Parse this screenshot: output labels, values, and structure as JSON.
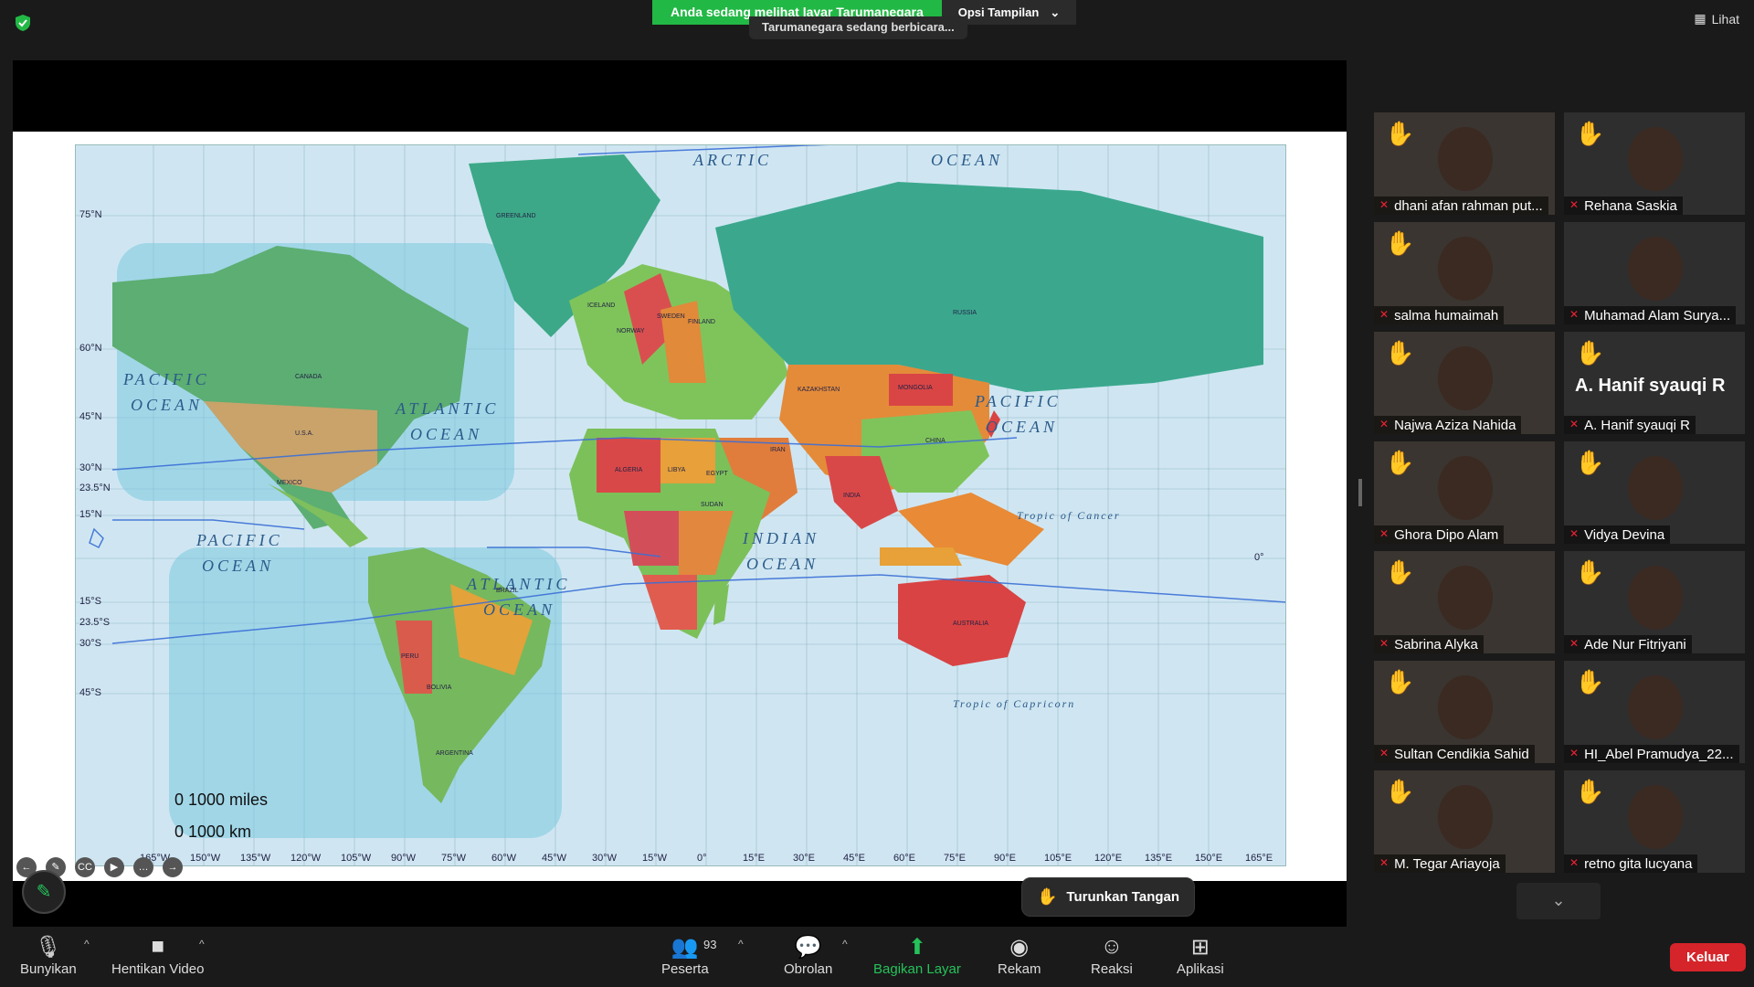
{
  "top": {
    "share_notice": "Anda sedang melihat layar Tarumanegara",
    "view_options": "Opsi Tampilan",
    "speaking": "Tarumanegara sedang berbicara...",
    "view_button": "Lihat"
  },
  "map": {
    "ocean_labels": [
      "ARCTIC",
      "OCEAN",
      "PACIFIC",
      "OCEAN",
      "ATLANTIC",
      "OCEAN",
      "PACIFIC",
      "OCEAN",
      "ATLANTIC",
      "OCEAN",
      "INDIAN",
      "OCEAN",
      "PACIFIC",
      "OCEAN"
    ],
    "tropic_cancer": "Tropic of Cancer",
    "tropic_capricorn": "Tropic of Capricorn",
    "lat_labels": [
      "75°N",
      "60°N",
      "45°N",
      "30°N",
      "23.5°N",
      "15°N",
      "0°",
      "15°S",
      "23.5°S",
      "30°S",
      "45°S"
    ],
    "lon_labels": [
      "165°W",
      "150°W",
      "135°W",
      "120°W",
      "105°W",
      "90°W",
      "75°W",
      "60°W",
      "45°W",
      "30°W",
      "15°W",
      "0°",
      "15°E",
      "30°E",
      "45°E",
      "60°E",
      "75°E",
      "90°E",
      "105°E",
      "120°E",
      "135°E",
      "150°E",
      "165°E"
    ],
    "scale_miles": "0    1000 miles",
    "scale_km": "0    1000 km",
    "country_labels": [
      "GREENLAND",
      "ICELAND",
      "RUSSIA",
      "CANADA",
      "U.S.A.",
      "MEXICO",
      "BRAZIL",
      "AUSTRALIA",
      "CHINA",
      "INDIA",
      "KAZAKHSTAN",
      "MONGOLIA",
      "ALGERIA",
      "LIBYA",
      "EGYPT",
      "SUDAN",
      "IRAN",
      "ARGENTINA",
      "PERU",
      "BOLIVIA",
      "FINLAND",
      "SWEDEN",
      "NORWAY"
    ]
  },
  "participants": [
    {
      "name": "dhani afan rahman put...",
      "hand": true
    },
    {
      "name": "Rehana Saskia",
      "hand": true
    },
    {
      "name": "salma humaimah",
      "hand": true
    },
    {
      "name": "Muhamad Alam Surya...",
      "hand": false
    },
    {
      "name": "Najwa Aziza Nahida",
      "hand": true
    },
    {
      "name": "A. Hanif syauqi R",
      "hand": true,
      "big_name": "A. Hanif syauqi R"
    },
    {
      "name": "Ghora Dipo Alam",
      "hand": true
    },
    {
      "name": "Vidya Devina",
      "hand": true
    },
    {
      "name": "Sabrina Alyka",
      "hand": true
    },
    {
      "name": "Ade Nur Fitriyani",
      "hand": true
    },
    {
      "name": "Sultan Cendikia Sahid",
      "hand": true
    },
    {
      "name": "HI_Abel Pramudya_22...",
      "hand": true
    },
    {
      "name": "M. Tegar Ariayoja",
      "hand": true
    },
    {
      "name": "retno gita lucyana",
      "hand": true
    }
  ],
  "lower_hand": "Turunkan Tangan",
  "toolbar": {
    "unmute": "Bunyikan",
    "stop_video": "Hentikan Video",
    "participants": "Peserta",
    "participant_count": "93",
    "chat": "Obrolan",
    "share": "Bagikan Layar",
    "record": "Rekam",
    "reactions": "Reaksi",
    "apps": "Aplikasi",
    "leave": "Keluar"
  },
  "colors": {
    "share_green": "#22b845",
    "hand_yellow": "#f7c21a",
    "leave_red": "#d5242a"
  }
}
